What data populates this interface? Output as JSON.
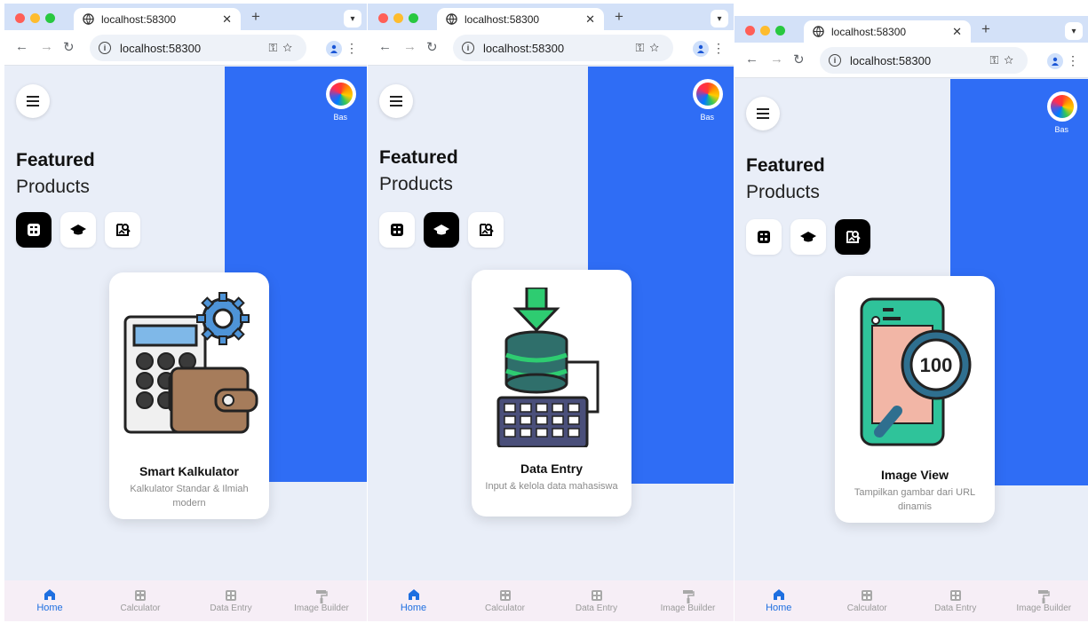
{
  "colors": {
    "accent": "#2f6df5",
    "nav_active": "#1e6fe0",
    "bg": "#e9eef8"
  },
  "panels": [
    {
      "tab_title": "localhost:58300",
      "url": "localhost:58300",
      "avatar_label": "Bas",
      "heading_bold": "Featured",
      "heading_light": "Products",
      "active_chip": 0,
      "card": {
        "title": "Smart Kalkulator",
        "description": "Kalkulator Standar & Ilmiah modern",
        "art_icon": "calculator-wallet-icon"
      },
      "nav": [
        {
          "label": "Home",
          "icon": "home-icon",
          "active": true
        },
        {
          "label": "Calculator",
          "icon": "calculator-icon",
          "active": false
        },
        {
          "label": "Data Entry",
          "icon": "data-entry-icon",
          "active": false
        },
        {
          "label": "Image Builder",
          "icon": "paint-roller-icon",
          "active": false
        }
      ]
    },
    {
      "tab_title": "localhost:58300",
      "url": "localhost:58300",
      "avatar_label": "Bas",
      "heading_bold": "Featured",
      "heading_light": "Products",
      "active_chip": 1,
      "card": {
        "title": "Data Entry",
        "description": "Input & kelola data mahasiswa",
        "art_icon": "database-keyboard-icon"
      },
      "nav": [
        {
          "label": "Home",
          "icon": "home-icon",
          "active": true
        },
        {
          "label": "Calculator",
          "icon": "calculator-icon",
          "active": false
        },
        {
          "label": "Data Entry",
          "icon": "data-entry-icon",
          "active": false
        },
        {
          "label": "Image Builder",
          "icon": "paint-roller-icon",
          "active": false
        }
      ]
    },
    {
      "tab_title": "localhost:58300",
      "url": "localhost:58300",
      "avatar_label": "Bas",
      "heading_bold": "Featured",
      "heading_light": "Products",
      "active_chip": 2,
      "card": {
        "title": "Image View",
        "description": "Tampilkan gambar dari URL dinamis",
        "art_icon": "phone-magnifier-icon",
        "art_text": "100"
      },
      "nav": [
        {
          "label": "Home",
          "icon": "home-icon",
          "active": true
        },
        {
          "label": "Calculator",
          "icon": "calculator-icon",
          "active": false
        },
        {
          "label": "Data Entry",
          "icon": "data-entry-icon",
          "active": false
        },
        {
          "label": "Image Builder",
          "icon": "paint-roller-icon",
          "active": false
        }
      ]
    }
  ]
}
